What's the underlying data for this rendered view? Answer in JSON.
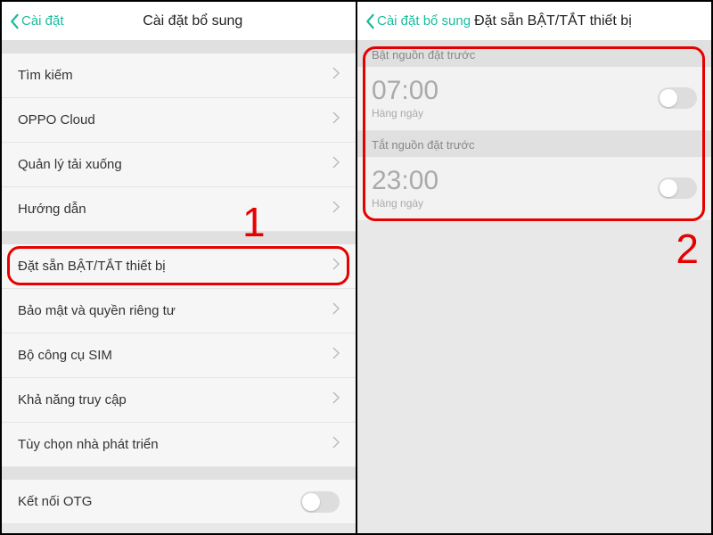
{
  "colors": {
    "accent": "#1abc9c",
    "highlight": "#e60000"
  },
  "left": {
    "back_label": "Cài đặt",
    "title": "Cài đặt bổ sung",
    "items_group1": [
      "Tìm kiếm",
      "OPPO Cloud",
      "Quản lý tải xuống",
      "Hướng dẫn"
    ],
    "items_group2": [
      "Đặt sẵn BẬT/TẮT thiết bị",
      "Bảo mật và quyền riêng tư",
      "Bộ công cụ SIM",
      "Khả năng truy cập",
      "Tùy chọn nhà phát triển"
    ],
    "otg_label": "Kết nối OTG",
    "step_number": "1"
  },
  "right": {
    "back_label": "Cài đặt bổ sung",
    "title": "Đặt sẵn BẬT/TẮT thiết bị",
    "scheduled_on": {
      "header": "Bật nguồn đặt trước",
      "time": "07:00",
      "freq": "Hàng ngày"
    },
    "scheduled_off": {
      "header": "Tắt nguồn đặt trước",
      "time": "23:00",
      "freq": "Hàng ngày"
    },
    "step_number": "2"
  }
}
